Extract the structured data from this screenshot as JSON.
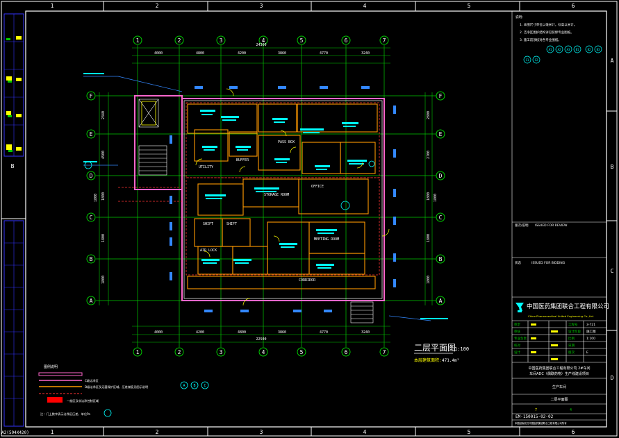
{
  "frame": {
    "col_labels_top": [
      "1",
      "2",
      "3",
      "4",
      "5",
      "6"
    ],
    "col_labels_bottom": [
      "1",
      "2",
      "3",
      "4",
      "5",
      "6"
    ],
    "row_labels_left": [
      "B"
    ],
    "row_labels_right": [
      "A",
      "B",
      "C",
      "D"
    ],
    "sheet_size": "A2(594X420)"
  },
  "grid": {
    "cols": [
      "1",
      "2",
      "3",
      "4",
      "5",
      "6",
      "7"
    ],
    "rows": [
      "F",
      "E",
      "D",
      "C",
      "B",
      "A"
    ],
    "top_total": "24300",
    "top_spans": [
      "4000",
      "4800",
      "4200",
      "3860",
      "4770",
      "3240"
    ],
    "bottom_total": "22500",
    "bottom_spans": [
      "4000",
      "4200",
      "4800",
      "3860",
      "4770",
      "3240"
    ],
    "left_dims": [
      "2340",
      "4500",
      "1800",
      "1800",
      "1800",
      "1800"
    ],
    "right_dims": [
      "2800",
      "2700",
      "1800",
      "1800",
      "1800",
      "1800"
    ]
  },
  "plan": {
    "title": "二层平面图",
    "scale": "1:100",
    "area_label": "本层建筑面积：",
    "area_value": "471.4m²",
    "room_tags": [
      "SHIFT",
      "SHIFT",
      "UTILITY",
      "STORAGE ROOM",
      "MEETING ROOM",
      "BUFFER",
      "OFFICE",
      "PASS BOX",
      "CORRIDOR",
      "AIR LOCK"
    ]
  },
  "legend": {
    "title": "图例说明",
    "items": [
      "C级洁净区",
      "D级洁净区及无菌保护区域，压差梯度见图示说明",
      "一般区及非洁净控制区域"
    ],
    "note": "注：门上数字表示洁净区压差，单位Pa",
    "detail_tags": [
      "A",
      "B",
      "C"
    ]
  },
  "titleblock": {
    "notes_header": "说明：",
    "notes": [
      "1. 本图尺寸单位以毫米计，标高以米计。",
      "2. 洁净区围护结构详见装修专业图纸。",
      "3. 施工前须核对各专业图纸。"
    ],
    "notes_tags": [
      "A1",
      "A2",
      "A3",
      "B1",
      "B2",
      "B3",
      "C1",
      "C2"
    ],
    "issue_label": "版次/说明",
    "issue_value": "ISSUED FOR REVIEW",
    "status_label": "状态",
    "status_value": "ISSUED FOR BIDDING",
    "company": "中国医药集团联合工程有限公司",
    "company_sub": "China Pharmaceutical United Engineering Co.,Ltd.",
    "rows": [
      {
        "label": "审定",
        "value": "",
        "code": "工程号",
        "codeval": "3-721"
      },
      {
        "label": "审核",
        "value": "",
        "code": "设计阶段",
        "codeval": "施工图"
      },
      {
        "label": "专业负责",
        "value": "",
        "code": "比例",
        "codeval": "1:100"
      },
      {
        "label": "校对",
        "value": "",
        "code": "日期",
        "codeval": ""
      },
      {
        "label": "设计",
        "value": "",
        "code": "版次",
        "codeval": "E"
      }
    ],
    "project": "中国医药集团联合工程有限公司 2#车间",
    "project2": "车间ADC（偶联药物）生产线建设项目",
    "unit_title": "生产车间",
    "drawing_title": "二层平面图",
    "drawing_no": "EM-150015-02-02",
    "footer_left": "7",
    "footer_right": "4",
    "footer_note": "本图纸版权归中国医药集团联合工程有限公司所有"
  }
}
